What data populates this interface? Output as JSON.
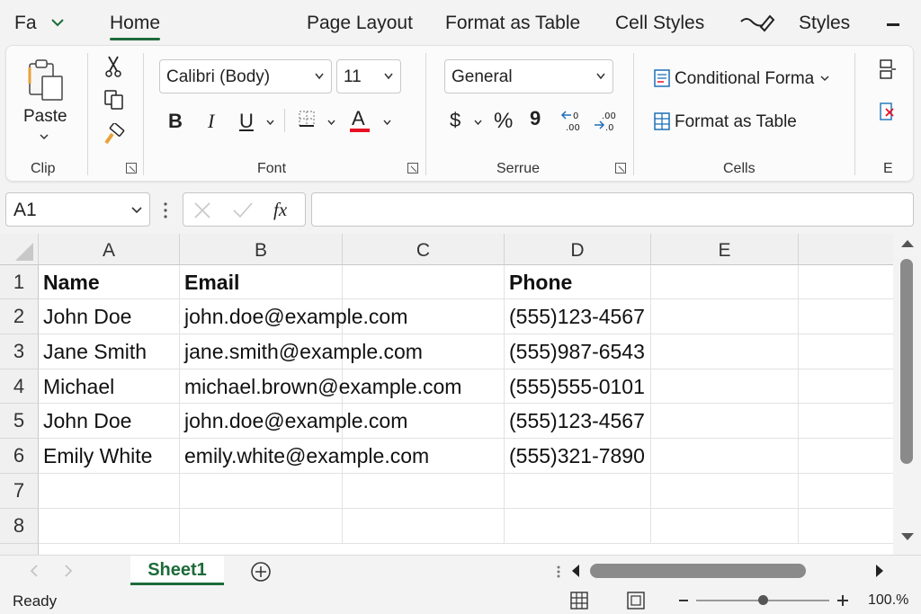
{
  "tabs": {
    "file_short": "Fa",
    "home": "Home",
    "page_layout": "Page Layout",
    "format_as_table": "Format as Table",
    "cell_styles": "Cell Styles",
    "styles": "Styles"
  },
  "ribbon": {
    "clipboard": {
      "paste_label": "Paste",
      "group_label": "Clip"
    },
    "font": {
      "font_name": "Calibri (Body)",
      "font_size": "11",
      "bold": "B",
      "italic": "I",
      "underline": "U",
      "font_color_glyph": "A",
      "font_color": "#e81123",
      "group_label": "Font"
    },
    "number": {
      "format": "General",
      "currency": "$",
      "percent": "%",
      "comma": "9",
      "group_label": "Serrue"
    },
    "cells": {
      "conditional_formatting": "Conditional Forma",
      "format_as_table": "Format as Table",
      "group_label": "Cells"
    },
    "editing": {
      "group_label": "E"
    }
  },
  "formula_bar": {
    "name_box": "A1",
    "fx": "fx",
    "formula": ""
  },
  "grid": {
    "columns": [
      "A",
      "B",
      "C",
      "D",
      "E"
    ],
    "rows": [
      "1",
      "2",
      "3",
      "4",
      "5",
      "6",
      "7",
      "8"
    ],
    "cells": [
      [
        "Name",
        "Email",
        "",
        "Phone",
        ""
      ],
      [
        "John Doe",
        "john.doe@example.com",
        "",
        "(555)123-4567",
        ""
      ],
      [
        "Jane Smith",
        "jane.smith@example.com",
        "",
        "(555)987-6543",
        ""
      ],
      [
        "Michael",
        "michael.brown@example.com",
        "",
        "(555)555-0101",
        ""
      ],
      [
        "John Doe",
        "john.doe@example.com",
        "",
        "(555)123-4567",
        ""
      ],
      [
        "Emily White",
        "emily.white@example.com",
        "",
        "(555)321-7890",
        ""
      ],
      [
        "",
        "",
        "",
        "",
        ""
      ],
      [
        "",
        "",
        "",
        "",
        ""
      ]
    ]
  },
  "sheets": {
    "active": "Sheet1"
  },
  "status": {
    "ready": "Ready",
    "zoom": "100.%",
    "zoom_fraction": 0.5
  },
  "colors": {
    "accent": "#1d6b3a",
    "ribbon_bg": "#fbfbfb",
    "header_bg": "#f0f0f0"
  }
}
